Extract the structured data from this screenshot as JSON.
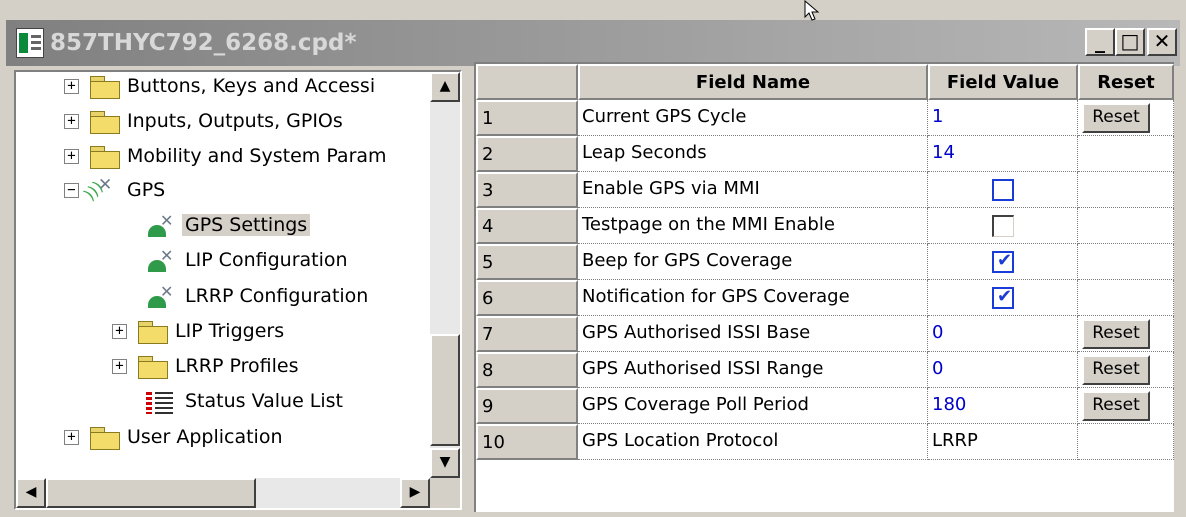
{
  "window": {
    "title": "857THYC792_6268.cpd*",
    "icon": "cpd-file-icon",
    "controls": {
      "minimize": "_",
      "maximize": "□",
      "close": "✕"
    }
  },
  "tree": {
    "items": [
      {
        "label": "Buttons, Keys and Accessi",
        "icon": "folder-icon",
        "expander": "+"
      },
      {
        "label": "Inputs, Outputs, GPIOs",
        "icon": "folder-icon",
        "expander": "+"
      },
      {
        "label": "Mobility and System Param",
        "icon": "folder-icon",
        "expander": "+"
      },
      {
        "label": "GPS",
        "icon": "gps-icon",
        "expander": "−"
      },
      {
        "label": "GPS Settings",
        "icon": "satellite-icon",
        "selected": true
      },
      {
        "label": "LIP Configuration",
        "icon": "satellite-icon"
      },
      {
        "label": "LRRP Configuration",
        "icon": "satellite-icon"
      },
      {
        "label": "LIP Triggers",
        "icon": "folder-icon",
        "expander": "+"
      },
      {
        "label": "LRRP Profiles",
        "icon": "folder-icon",
        "expander": "+"
      },
      {
        "label": "Status Value List",
        "icon": "list-icon"
      },
      {
        "label": "User Application",
        "icon": "folder-icon",
        "expander": "+"
      }
    ],
    "scroll_up": "▲",
    "scroll_down": "▼",
    "scroll_left": "◀",
    "scroll_right": "▶"
  },
  "grid": {
    "headers": {
      "name": "Field Name",
      "value": "Field Value",
      "reset": "Reset"
    },
    "rows": [
      {
        "num": "1",
        "name": "Current GPS Cycle",
        "value": "1",
        "reset": "Reset"
      },
      {
        "num": "2",
        "name": "Leap Seconds",
        "value": "14"
      },
      {
        "num": "3",
        "name": "Enable GPS via MMI",
        "checkbox": "unchecked"
      },
      {
        "num": "4",
        "name": "Testpage on the MMI Enable",
        "checkbox": "unchecked"
      },
      {
        "num": "5",
        "name": "Beep for GPS Coverage",
        "checkbox": "checked"
      },
      {
        "num": "6",
        "name": "Notification for GPS Coverage",
        "checkbox": "checked"
      },
      {
        "num": "7",
        "name": "GPS Authorised ISSI Base",
        "value": "0",
        "reset": "Reset"
      },
      {
        "num": "8",
        "name": "GPS Authorised ISSI Range",
        "value": "0",
        "reset": "Reset"
      },
      {
        "num": "9",
        "name": "GPS Coverage Poll Period",
        "value": "180",
        "reset": "Reset"
      },
      {
        "num": "10",
        "name": "GPS Location Protocol",
        "value": "LRRP"
      }
    ]
  },
  "colors": {
    "accent": "#1a3cd6",
    "value_text": "#0000cc",
    "face": "#d4d0c8"
  }
}
